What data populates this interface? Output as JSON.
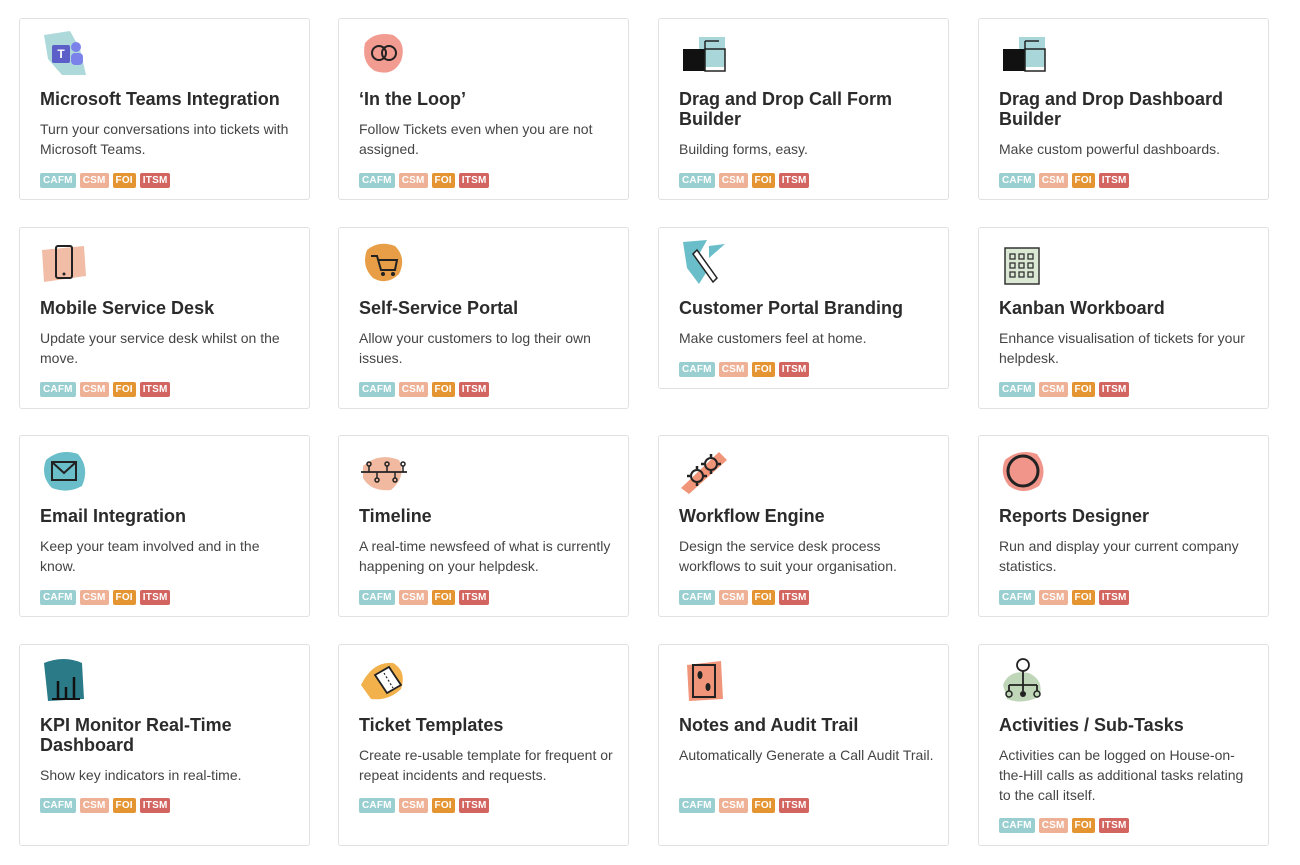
{
  "colors": {
    "cafm": "#9acfd1",
    "csm": "#eeb196",
    "foi": "#e59432",
    "itsm": "#d2655f"
  },
  "tags": {
    "cafm": "CAFM",
    "csm": "CSM",
    "foi": "FOI",
    "itsm": "ITSM"
  },
  "cards": [
    {
      "icon": "teams-icon",
      "title": "Microsoft Teams Integration",
      "desc": "Turn your conversations into tickets with Microsoft Teams."
    },
    {
      "icon": "loop-icon",
      "title": "‘In the Loop’",
      "desc": "Follow Tickets even when you are not assigned."
    },
    {
      "icon": "drag-drop-icon",
      "title": "Drag and Drop Call Form Builder",
      "desc": "Building forms, easy."
    },
    {
      "icon": "drag-drop-icon",
      "title": "Drag and Drop Dashboard Builder",
      "desc": "Make custom powerful dashboards."
    },
    {
      "icon": "mobile-icon",
      "title": "Mobile Service Desk",
      "desc": "Update your service desk whilst on the move."
    },
    {
      "icon": "cart-icon",
      "title": "Self-Service Portal",
      "desc": "Allow your customers to log their own issues."
    },
    {
      "icon": "brush-icon",
      "title": "Customer Portal Branding",
      "desc": "Make customers feel at home."
    },
    {
      "icon": "kanban-icon",
      "title": "Kanban Workboard",
      "desc": "Enhance visualisation of tickets for your helpdesk."
    },
    {
      "icon": "envelope-icon",
      "title": "Email Integration",
      "desc": "Keep your team involved and in the know."
    },
    {
      "icon": "timeline-icon",
      "title": "Timeline",
      "desc": "A real-time newsfeed of what is currently happening on your helpdesk."
    },
    {
      "icon": "gears-icon",
      "title": "Workflow Engine",
      "desc": "Design the service desk process workflows to suit your organisation."
    },
    {
      "icon": "ring-icon",
      "title": "Reports Designer",
      "desc": "Run and display your current company statistics."
    },
    {
      "icon": "bar-chart-icon",
      "title": "KPI Monitor Real-Time Dashboard",
      "desc": "Show key indicators in real-time."
    },
    {
      "icon": "ticket-icon",
      "title": "Ticket Templates",
      "desc": "Create re-usable template for frequent or repeat incidents and requests."
    },
    {
      "icon": "footprints-icon",
      "title": "Notes and Audit Trail",
      "desc": "Automatically Generate a Call Audit Trail."
    },
    {
      "icon": "hierarchy-icon",
      "title": "Activities / Sub-Tasks",
      "desc": "Activities can be logged on House-on-the-Hill calls as additional tasks relating to the call itself."
    }
  ]
}
